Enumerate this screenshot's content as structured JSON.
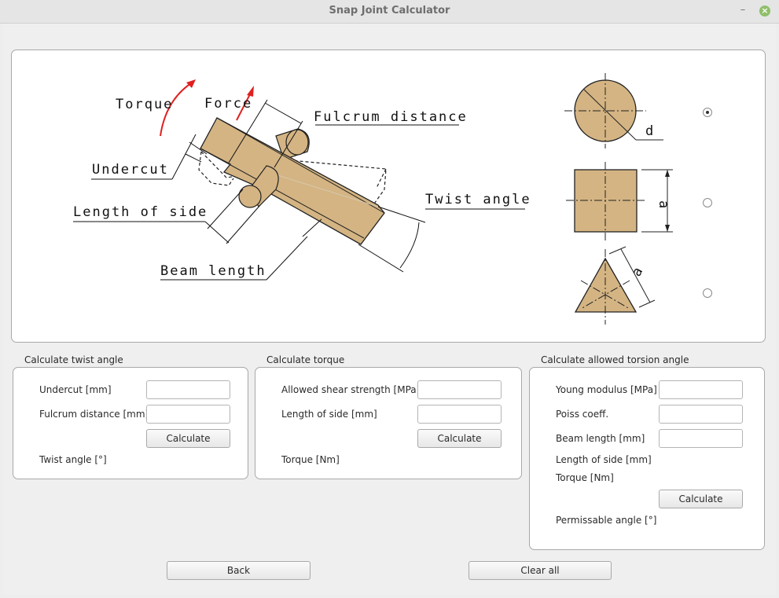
{
  "window": {
    "title": "Snap Joint Calculator",
    "minimize_glyph": "–",
    "close_glyph": "×"
  },
  "diagram": {
    "labels": {
      "torque": "Torque",
      "force": "Force",
      "fulcrum_distance": "Fulcrum distance",
      "undercut": "Undercut",
      "length_of_side": "Length of side",
      "twist_angle": "Twist angle",
      "beam_length": "Beam length"
    },
    "shapes": [
      {
        "name": "circle",
        "dim_label": "d",
        "selected": true
      },
      {
        "name": "square",
        "dim_label": "a",
        "selected": false
      },
      {
        "name": "triangle",
        "dim_label": "a",
        "selected": false
      }
    ],
    "colors": {
      "material": "#d4b483",
      "arrow": "#e02020"
    }
  },
  "twist": {
    "title": "Calculate twist angle",
    "undercut_label": "Undercut [mm]",
    "fulcrum_label": "Fulcrum distance [mm]",
    "calculate": "Calculate",
    "result_label": "Twist angle [°]"
  },
  "torque": {
    "title": "Calculate torque",
    "shear_label": "Allowed shear strength [MPa]",
    "side_label": "Length of side [mm]",
    "calculate": "Calculate",
    "result_label": "Torque [Nm]"
  },
  "torsion": {
    "title": "Calculate allowed torsion angle",
    "young_label": "Young modulus [MPa]",
    "poiss_label": "Poiss coeff.",
    "beam_label": "Beam length [mm]",
    "side_label": "Length of side [mm]",
    "torque_label": "Torque [Nm]",
    "calculate": "Calculate",
    "result_label": "Permissable angle [°]"
  },
  "footer": {
    "back": "Back",
    "clear": "Clear all"
  }
}
